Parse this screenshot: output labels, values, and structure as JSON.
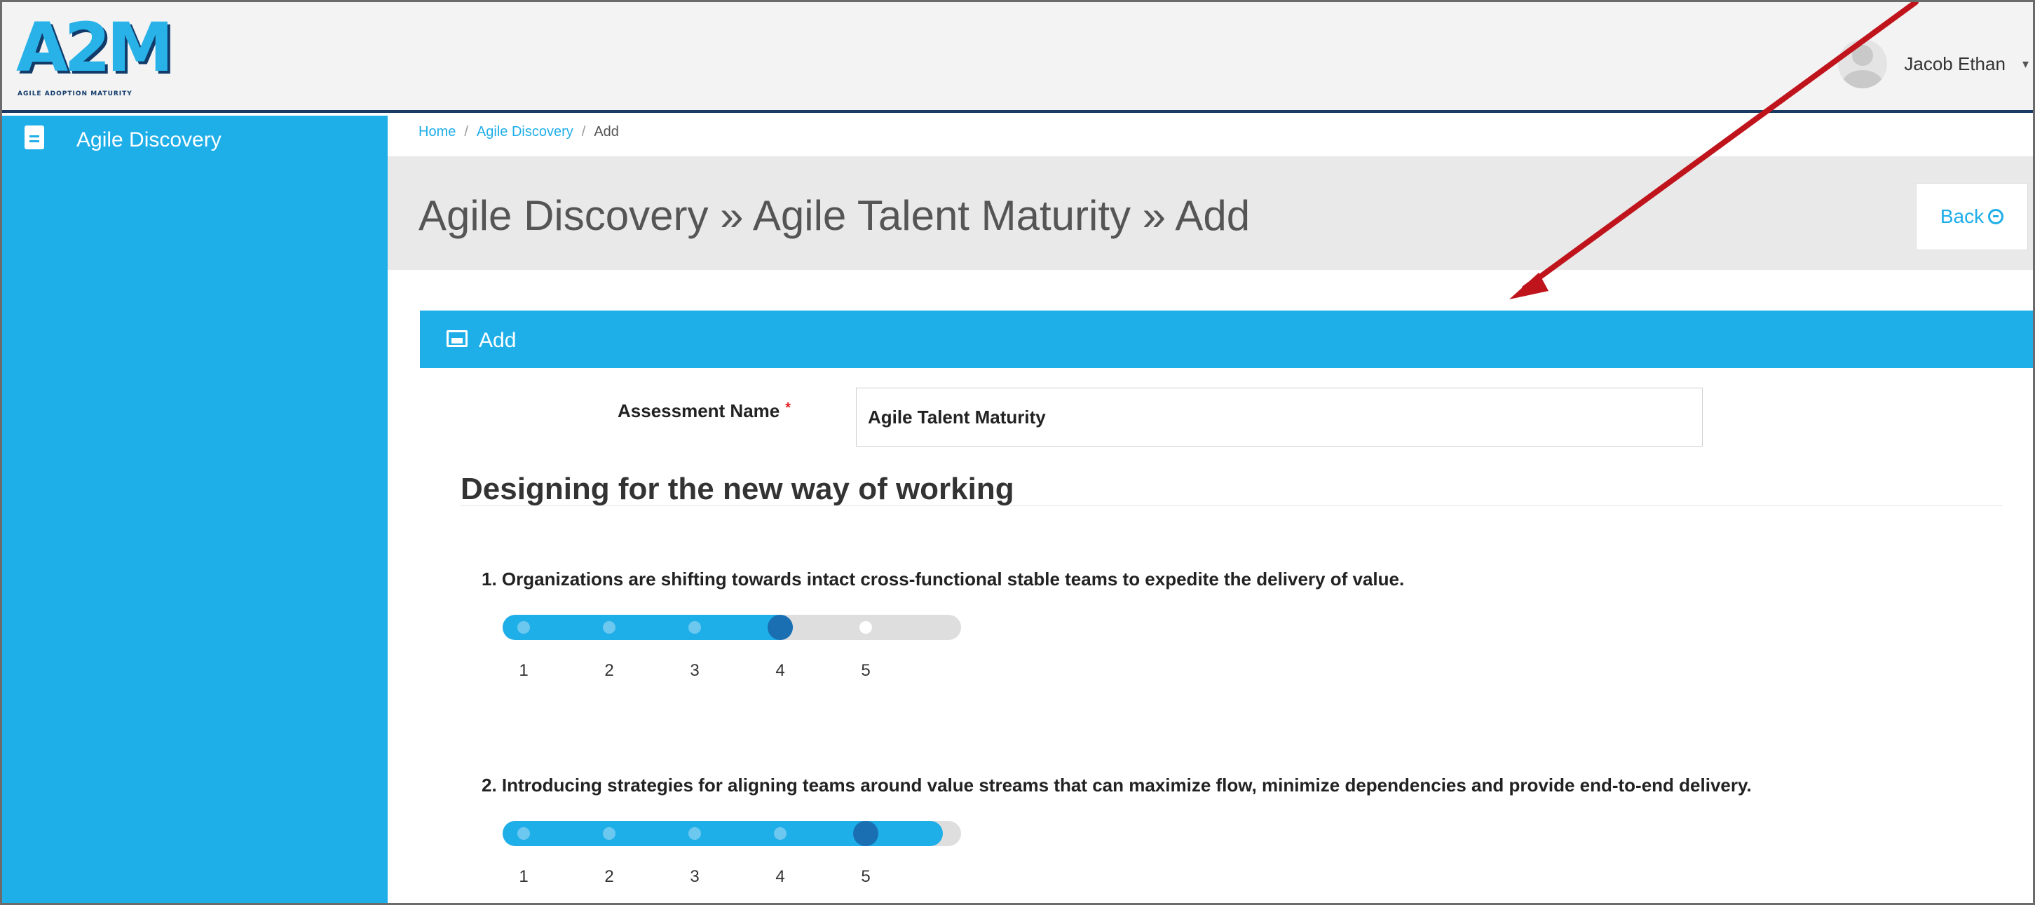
{
  "app": {
    "logo_text": "A2M",
    "logo_tagline": "AGILE ADOPTION MATURITY"
  },
  "user": {
    "name": "Jacob Ethan",
    "caret": "▾"
  },
  "sidebar": {
    "items": [
      {
        "label": "Agile Discovery",
        "icon": "document-icon"
      }
    ]
  },
  "breadcrumb": {
    "items": [
      "Home",
      "Agile Discovery",
      "Add"
    ],
    "separator": "/"
  },
  "header": {
    "title": "Agile Discovery » Agile Talent Maturity » Add",
    "back_label": "Back"
  },
  "panel": {
    "title": "Add"
  },
  "form": {
    "assessment_label": "Assessment Name",
    "required_mark": "*",
    "assessment_value": "Agile Talent Maturity"
  },
  "section": {
    "title": "Designing for the new way of working"
  },
  "questions": [
    {
      "text": "1. Organizations are shifting towards intact cross-functional stable teams to expedite the delivery of value.",
      "scale": [
        "1",
        "2",
        "3",
        "4",
        "5"
      ],
      "selected": 4
    },
    {
      "text": "2. Introducing strategies for aligning teams around value streams that can maximize ﬂow, minimize dependencies and provide end-to-end delivery.",
      "scale": [
        "1",
        "2",
        "3",
        "4",
        "5"
      ],
      "selected": 5
    }
  ],
  "colors": {
    "accent": "#1eaee8",
    "knob": "#1a6fb3",
    "arrow": "#c0141c",
    "header_border": "#1b3a63"
  }
}
